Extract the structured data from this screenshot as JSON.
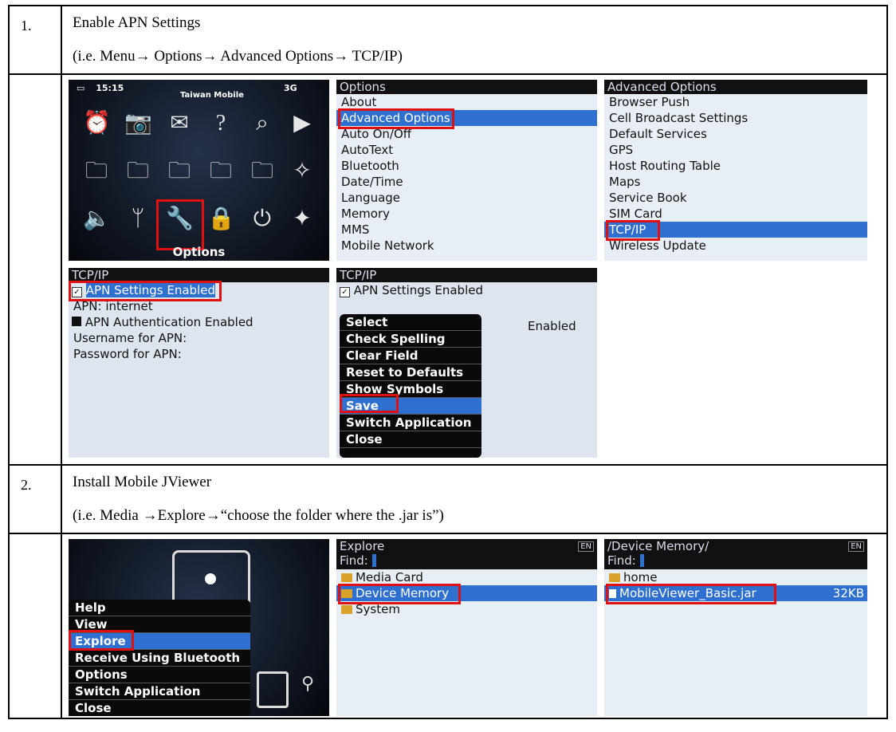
{
  "steps": [
    {
      "number": "1.",
      "title": "Enable APN Settings",
      "path": "(i.e. Menu→ Options→ Advanced Options→ TCP/IP)"
    },
    {
      "number": "2.",
      "title": "Install Mobile JViewer",
      "path": "(i.e. Media →Explore→“choose the folder where the .jar is”)"
    }
  ],
  "home_screen": {
    "time": "15:15",
    "carrier": "Taiwan Mobile",
    "network": "3G",
    "selected_label": "Options"
  },
  "options_screen": {
    "title": "Options",
    "items": [
      "About",
      "Advanced Options",
      "Auto On/Off",
      "AutoText",
      "Bluetooth",
      "Date/Time",
      "Language",
      "Memory",
      "MMS",
      "Mobile Network"
    ]
  },
  "advanced_screen": {
    "title": "Advanced Options",
    "items": [
      "Browser Push",
      "Cell Broadcast Settings",
      "Default Services",
      "GPS",
      "Host Routing Table",
      "Maps",
      "Service Book",
      "SIM Card",
      "TCP/IP",
      "Wireless Update"
    ]
  },
  "tcpip_screen": {
    "title": "TCP/IP",
    "apn_enabled": "APN Settings Enabled",
    "apn": "APN: internet",
    "auth": "APN Authentication Enabled",
    "username": "Username for APN:",
    "password": "Password for APN:"
  },
  "tcpip_menu_screen": {
    "title": "TCP/IP",
    "apn_enabled": "APN Settings Enabled",
    "behind": "Enabled",
    "menu": [
      "Select",
      "Check Spelling",
      "Clear Field",
      "Reset to Defaults",
      "Show Symbols",
      "Save",
      "Switch Application",
      "Close"
    ]
  },
  "media_menu": {
    "items": [
      "Help",
      "View",
      "Explore",
      "Receive Using Bluetooth",
      "Options",
      "Switch Application",
      "Close"
    ]
  },
  "explore_screen": {
    "title": "Explore",
    "find": "Find:",
    "lang": "EN",
    "items": [
      "Media Card",
      "Device Memory",
      "System"
    ]
  },
  "device_memory_screen": {
    "title": "/Device Memory/",
    "find": "Find:",
    "lang": "EN",
    "folder": "home",
    "file": "MobileViewer_Basic.jar",
    "size": "32KB"
  }
}
